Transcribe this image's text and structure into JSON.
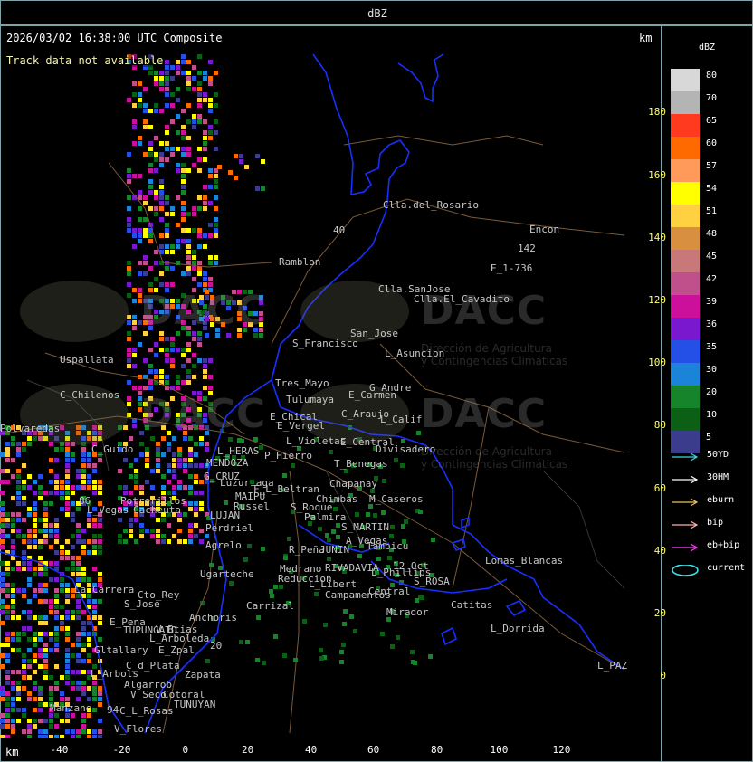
{
  "window": {
    "title": "dBZ"
  },
  "header": {
    "timestamp": "2026/03/02 16:38:00 UTC Composite",
    "track_status": "Track data not available",
    "unit_top": "km",
    "unit_bottom": "km"
  },
  "axes": {
    "y_ticks": [
      "180",
      "160",
      "140",
      "120",
      "100",
      "80",
      "60",
      "40",
      "20",
      "0"
    ],
    "x_ticks": [
      "-40",
      "-20",
      "0",
      "20",
      "40",
      "60",
      "80",
      "100",
      "120"
    ]
  },
  "legend": {
    "title": "dBZ",
    "levels": [
      {
        "label": "80",
        "color": "#d8d8d8"
      },
      {
        "label": "70",
        "color": "#b4b4b4"
      },
      {
        "label": "65",
        "color": "#ff3a1e"
      },
      {
        "label": "60",
        "color": "#ff6a00"
      },
      {
        "label": "57",
        "color": "#ff9a5a"
      },
      {
        "label": "54",
        "color": "#ffff00"
      },
      {
        "label": "51",
        "color": "#ffd040"
      },
      {
        "label": "48",
        "color": "#d89040"
      },
      {
        "label": "45",
        "color": "#c87878"
      },
      {
        "label": "42",
        "color": "#c0508c"
      },
      {
        "label": "39",
        "color": "#cc109c"
      },
      {
        "label": "36",
        "color": "#7a18d0"
      },
      {
        "label": "35",
        "color": "#2450e8"
      },
      {
        "label": "30",
        "color": "#1c84d8"
      },
      {
        "label": "20",
        "color": "#16842a"
      },
      {
        "label": "10",
        "color": "#0c6016"
      },
      {
        "label": "5",
        "color": "#3c3c8c"
      }
    ],
    "tracks": [
      {
        "label": "50YD",
        "color": "#40d8e0",
        "shape": "arrow"
      },
      {
        "label": "30HM",
        "color": "#ffffff",
        "shape": "arrow"
      },
      {
        "label": "eburn",
        "color": "#f0c060",
        "shape": "arrow"
      },
      {
        "label": "bip",
        "color": "#ffb0b0",
        "shape": "arrow"
      },
      {
        "label": "eb+bip",
        "color": "#ff40ff",
        "shape": "arrow"
      },
      {
        "label": "current",
        "color": "#40e0e8",
        "shape": "ellipse"
      }
    ]
  },
  "watermark": {
    "logo": "DACC",
    "line1": "Dirección de Agricultura",
    "line2": "y Contingencias Climáticas"
  },
  "places": [
    "Clla.del_Rosario",
    "Encon",
    "142",
    "E_1-736",
    "Ramblon",
    "Clla.SanJose",
    "Clla.El_Cavadito",
    "San_Jose",
    "S_Francisco",
    "L_Asuncion",
    "Uspallata",
    "Polvaredas",
    "Tres_Mayo",
    "G_Andre",
    "Tulumaya",
    "E_Carmen",
    "C_Chilenos",
    "E_Chical",
    "C_Araujo",
    "L_Calif",
    "E_Vergel",
    "C_Guido",
    "L_HERAS",
    "L_Violetas",
    "E_Central",
    "Divisadero",
    "P_Hierro",
    "MENDOZA",
    "T_Benegas",
    "G_CRUZ",
    "Luzuriaga",
    "F_L_Beltran",
    "Chapanay",
    "MAIPU",
    "Russel",
    "Chimbas",
    "M_Caseros",
    "Potrerillos",
    "Cacheuta",
    "L_Vegas",
    "LUJAN",
    "S_Roque",
    "Perdriel",
    "Palmira",
    "S_MARTIN",
    "A_Vegas",
    "Agrelo",
    "R_Peña",
    "JUNIN",
    "Tambicu",
    "Ugarteche",
    "Medrano",
    "RIVADAVIA",
    "12_Oct",
    "L_Phillips",
    "Lomas_Blancas",
    "Reduccion",
    "L_Libert",
    "S_ROSA",
    "La_Carrera",
    "Cto_Rey",
    "S_Jose",
    "Carrizal",
    "Campamentos",
    "Central",
    "Catitas",
    "E_Pena",
    "TUPUNGATO",
    "V_Btias",
    "Anchoris",
    "Mirador",
    "L_Dorrida",
    "L_Arboleda",
    "Gltallary",
    "E_Zpal",
    "C_d_Plata",
    "L_Arbols",
    "Zapata",
    "L_PAZ",
    "Algarrob",
    "V_Seco",
    "Cotoral",
    "TUNUYAN",
    "Manzano",
    "C_L_Rosas",
    "V_Flores",
    "94",
    "86",
    "40",
    "20"
  ]
}
